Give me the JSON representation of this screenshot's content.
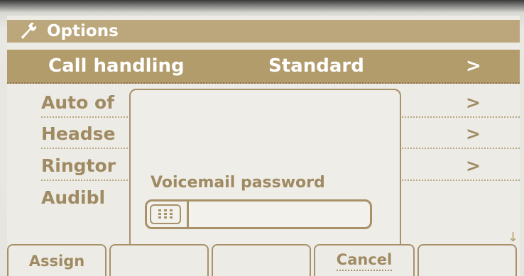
{
  "header": {
    "title": "Options",
    "icon": "wrench-icon"
  },
  "menu": {
    "selected": {
      "label": "Call handling",
      "value": "Standard",
      "chevron": ">"
    },
    "items": [
      {
        "label": "Auto of",
        "chevron": ">"
      },
      {
        "label": "Headse",
        "chevron": ">"
      },
      {
        "label": "Ringtor",
        "chevron": ">"
      },
      {
        "label": "Audibl"
      }
    ]
  },
  "dialog": {
    "prompt": "Voicemail password",
    "input_value": "",
    "keypad_icon": "keypad-icon"
  },
  "softkeys": {
    "labels": [
      "Assign",
      "",
      "",
      "Cancel",
      ""
    ]
  },
  "scroll_indicator": "↓",
  "colors": {
    "accent": "#b39c6c",
    "text": "#9f8a62",
    "background": "#ecebe5"
  }
}
